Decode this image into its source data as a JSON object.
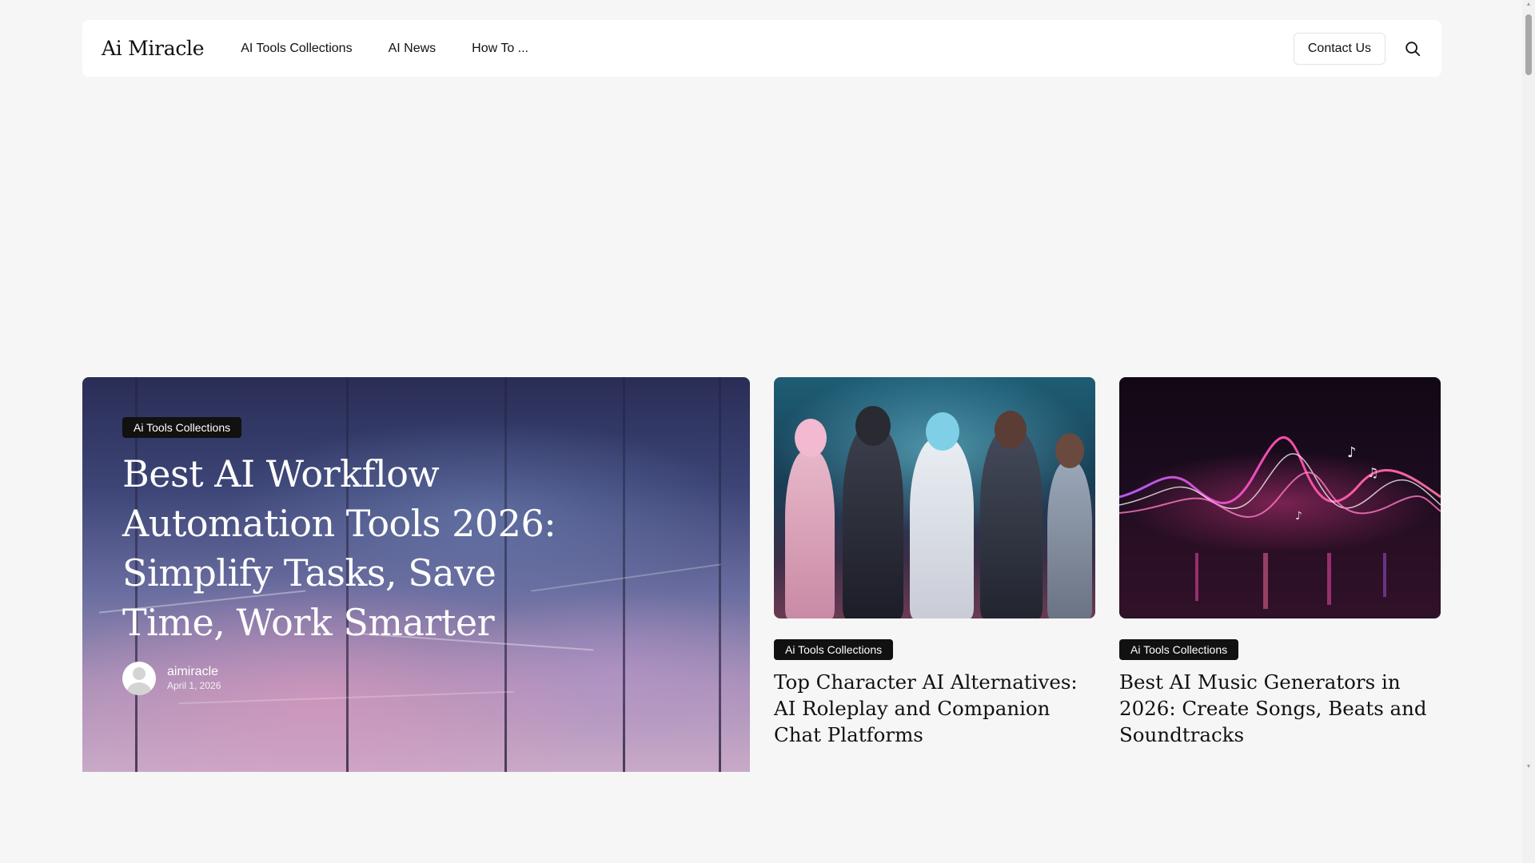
{
  "header": {
    "logo": "Ai Miracle",
    "nav": [
      {
        "label": "AI Tools Collections"
      },
      {
        "label": "AI News"
      },
      {
        "label": "How To ..."
      }
    ],
    "contact_label": "Contact Us",
    "search_icon": "search-icon"
  },
  "featured": {
    "category": "Ai Tools Collections",
    "title": "Best AI Workflow Automation Tools 2026: Simplify Tasks, Save Time, Work Smarter",
    "author": "aimiracle",
    "date": "April 1, 2026"
  },
  "cards": [
    {
      "category": "Ai Tools Collections",
      "title": "Top Character AI Alternatives: AI Roleplay and Companion Chat Platforms"
    },
    {
      "category": "Ai Tools Collections",
      "title": "Best AI Music Generators in 2026: Create Songs, Beats and Soundtracks"
    }
  ],
  "colors": {
    "page_bg": "#f6f6f6",
    "badge_bg": "#111111",
    "text": "#111111"
  }
}
